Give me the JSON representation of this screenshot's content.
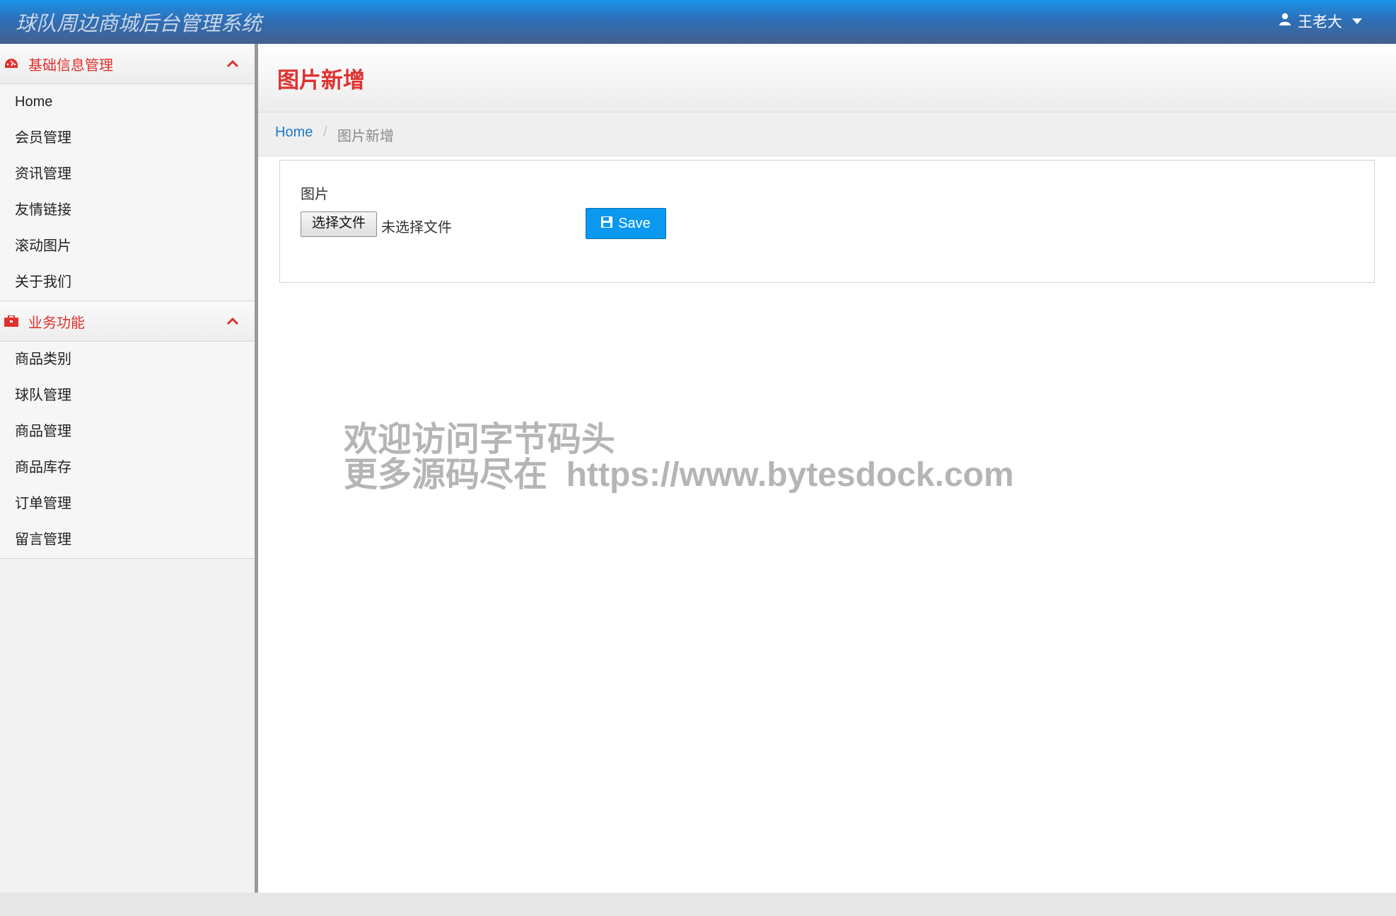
{
  "navbar": {
    "brand": "球队周边商城后台管理系统",
    "user_name": "王老大",
    "icons": {
      "user": "user-icon",
      "caret": "caret-down-icon"
    }
  },
  "sidebar": {
    "groups": [
      {
        "label": "基础信息管理",
        "icon": "dashboard-icon",
        "items": [
          "Home",
          "会员管理",
          "资讯管理",
          "友情链接",
          "滚动图片",
          "关于我们"
        ]
      },
      {
        "label": "业务功能",
        "icon": "briefcase-icon",
        "items": [
          "商品类别",
          "球队管理",
          "商品管理",
          "商品库存",
          "订单管理",
          "留言管理"
        ]
      }
    ]
  },
  "page": {
    "title": "图片新增",
    "breadcrumb": {
      "home": "Home",
      "separator": "/",
      "current": "图片新增"
    }
  },
  "form": {
    "image_label": "图片",
    "file_button": "选择文件",
    "file_status": "未选择文件",
    "save_label": "Save"
  },
  "watermark": {
    "line1": "欢迎访问字节码头",
    "line2": "更多源码尽在  https://www.bytesdock.com"
  },
  "colors": {
    "accent_red": "#e0312e",
    "primary_blue": "#0a98f0",
    "link_blue": "#1b7ac8"
  }
}
